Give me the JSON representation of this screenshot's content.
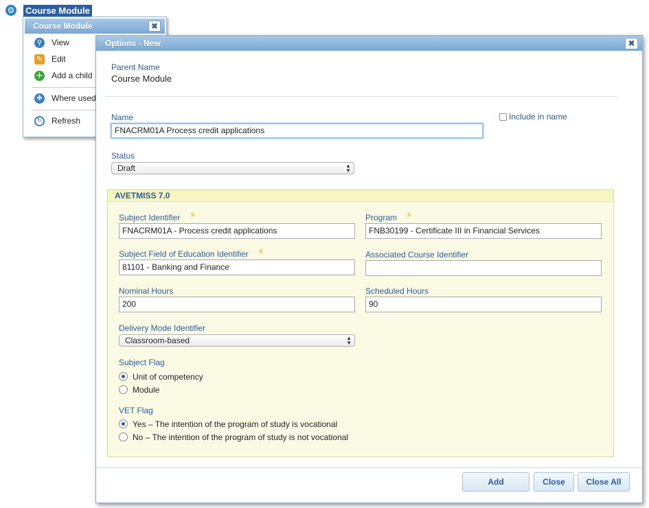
{
  "tree": {
    "node_label": "Course Module",
    "node_icon": "gear-icon"
  },
  "context_menu": {
    "title": "Course Module",
    "close_symbol": "✖",
    "items": [
      {
        "label": "View",
        "icon": "magnifier-icon"
      },
      {
        "label": "Edit",
        "icon": "pencil-icon"
      },
      {
        "label": "Add a child",
        "icon": "plus-icon"
      },
      {
        "label": "Where used",
        "icon": "puzzle-icon"
      },
      {
        "label": "Refresh",
        "icon": "refresh-icon"
      }
    ]
  },
  "dialog": {
    "title": "Options - New",
    "close_symbol": "✖",
    "parent_name_label": "Parent Name",
    "parent_name_value": "Course Module",
    "name_label": "Name",
    "name_value": "FNACRM01A Process credit applications",
    "include_in_name_label": "Include in name",
    "include_in_name_checked": false,
    "status_label": "Status",
    "status_value": "Draft",
    "avetmiss": {
      "title": "AVETMISS 7.0",
      "subject_identifier_label": "Subject Identifier",
      "subject_identifier_value": "FNACRM01A - Process credit applications",
      "program_label": "Program",
      "program_value": "FNB30199 - Certificate III in Financial Services",
      "subject_foe_label": "Subject Field of Education Identifier",
      "subject_foe_value": "81101 - Banking and Finance",
      "assoc_course_label": "Associated Course Identifier",
      "assoc_course_value": "",
      "nominal_hours_label": "Nominal Hours",
      "nominal_hours_value": "200",
      "scheduled_hours_label": "Scheduled Hours",
      "scheduled_hours_value": "90",
      "delivery_mode_label": "Delivery Mode Identifier",
      "delivery_mode_value": "Classroom-based",
      "subject_flag_label": "Subject Flag",
      "subject_flag_options": [
        "Unit of competency",
        "Module"
      ],
      "subject_flag_selected": "Unit of competency",
      "vet_flag_label": "VET Flag",
      "vet_flag_options": [
        "Yes – The intention of the program of study is vocational",
        "No – The intention of the program of study is not vocational"
      ],
      "vet_flag_selected": "Yes – The intention of the program of study is vocational",
      "lightning_symbol": "⚡"
    },
    "buttons": {
      "add": "Add",
      "close": "Close",
      "close_all": "Close All"
    }
  },
  "colors": {
    "header_blue": "#7aa8d4",
    "label_blue": "#2a5c9a",
    "panel_yellow": "#fbfbe5",
    "selected_node": "#2a5ea8"
  }
}
